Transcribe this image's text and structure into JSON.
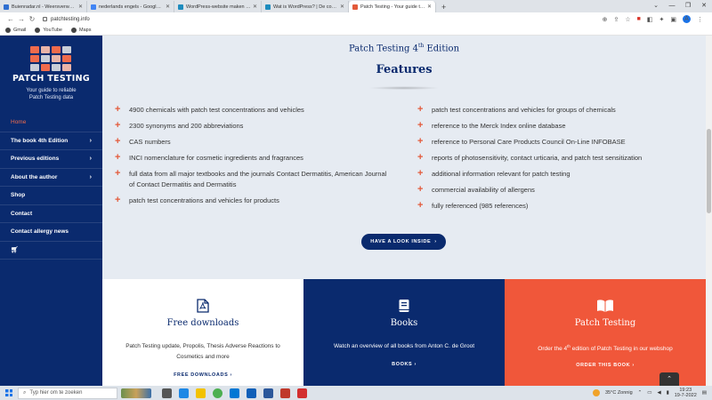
{
  "browser": {
    "tabs": [
      {
        "label": "Buienradar.nl - Weersverwachtin",
        "color": "#2f6fd1"
      },
      {
        "label": "nederlands engels - Google Zoek",
        "color": "#4285f4"
      },
      {
        "label": "WordPress-website maken | Bou",
        "color": "#1e8cbe"
      },
      {
        "label": "Wat is WordPress? | De complete",
        "color": "#1e8cbe"
      },
      {
        "label": "Patch Testing - Your guide to reli",
        "color": "#e35a3a",
        "active": true
      }
    ],
    "new_tab": "+",
    "url": "patchtesting.info",
    "bookmarks": [
      "Gmail",
      "YouTube",
      "Maps"
    ],
    "profile_initial": "A"
  },
  "sidebar": {
    "brand": "PATCH TESTING",
    "tagline_line1": "Your guide to reliable",
    "tagline_line2": "Patch Testing data",
    "logo_colors": [
      "#f06b4c",
      "#e9b4a8",
      "#f06b4c",
      "#c9ced8",
      "#f06b4c",
      "#c9ced8",
      "#e9b4a8",
      "#f06b4c",
      "#c9ced8",
      "#f06b4c",
      "#c9ced8",
      "#e9b4a8"
    ],
    "menu": [
      {
        "label": "Home",
        "active": true
      },
      {
        "label": "The book 4th Edition",
        "chevron": true
      },
      {
        "label": "Previous editions",
        "chevron": true
      },
      {
        "label": "About the author",
        "chevron": true
      },
      {
        "label": "Shop"
      },
      {
        "label": "Contact"
      },
      {
        "label": "Contact allergy news"
      }
    ]
  },
  "main": {
    "edition_prefix": "Patch Testing 4",
    "edition_sup": "th",
    "edition_suffix": " Edition",
    "features_title": "Features",
    "features_left": [
      "4900 chemicals with patch test concentrations and vehicles",
      "2300 synonyms and 200 abbreviations",
      "CAS numbers",
      "INCI nomenclature for cosmetic ingredients and fragrances",
      "full data from all major textbooks and the journals Contact Dermatitis, American Journal of Contact Dermatitis and Dermatitis",
      "patch test concentrations and vehicles for products"
    ],
    "features_right": [
      "patch test concentrations and vehicles for groups of chemicals",
      "reference to the Merck Index online database",
      "reference to Personal Care Products Council On-Line INFOBASE",
      "reports of photosensitivity, contact urticaria, and patch test sensitization",
      "additional information relevant for patch testing",
      "commercial availability of allergens",
      "fully referenced (985 references)"
    ],
    "cta": "HAVE A LOOK INSIDE"
  },
  "cards": [
    {
      "title": "Free downloads",
      "desc": "Patch Testing update, Propolis, Thesis Adverse Reactions to Cosmetics and more",
      "link": "FREE DOWNLOADS"
    },
    {
      "title": "Books",
      "desc": "Watch an overview of all books from Anton C. de Groot",
      "link": "BOOKS"
    },
    {
      "title": "Patch Testing",
      "desc_prefix": "Order the 4",
      "desc_sup": "th",
      "desc_suffix": " edition of Patch Testing in our webshop",
      "link": "ORDER THIS BOOK"
    }
  ],
  "taskbar": {
    "search_placeholder": "Typ hier om te zoeken",
    "weather": "35°C  Zonnig",
    "time": "19:23",
    "date": "19-7-2022"
  }
}
